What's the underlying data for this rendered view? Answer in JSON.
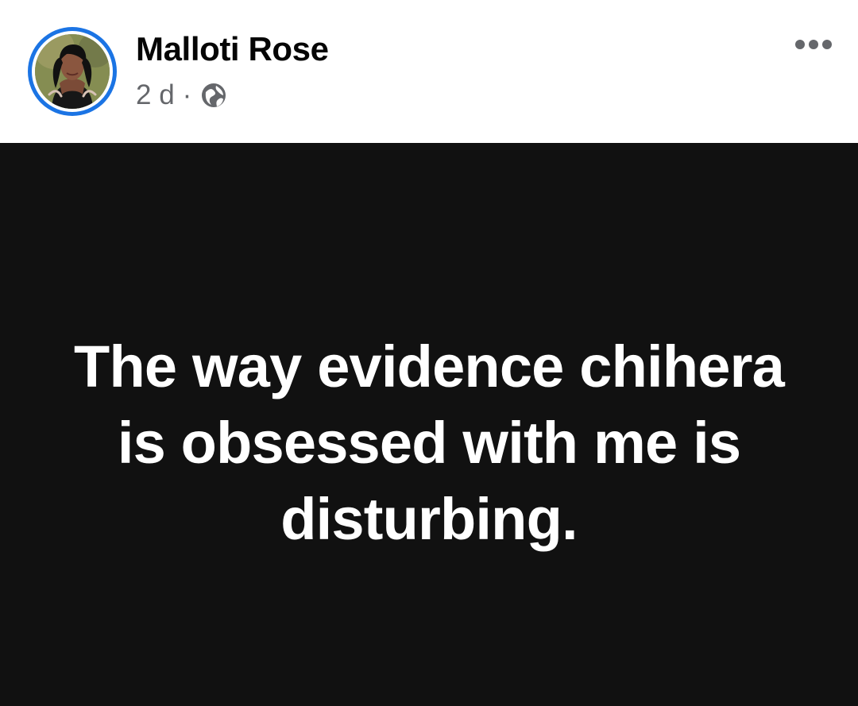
{
  "post": {
    "author": {
      "name": "Malloti Rose",
      "avatar_icon": "profile-photo",
      "avatar_ring_color": "#1b74e4"
    },
    "meta": {
      "time": "2 d",
      "separator": "·",
      "privacy_icon": "globe-icon"
    },
    "actions": {
      "more_icon": "more-horizontal-icon"
    },
    "content": {
      "text": "The way evidence chihera is obsessed with me is disturbing.",
      "background_color": "#111111",
      "text_color": "#ffffff"
    }
  }
}
